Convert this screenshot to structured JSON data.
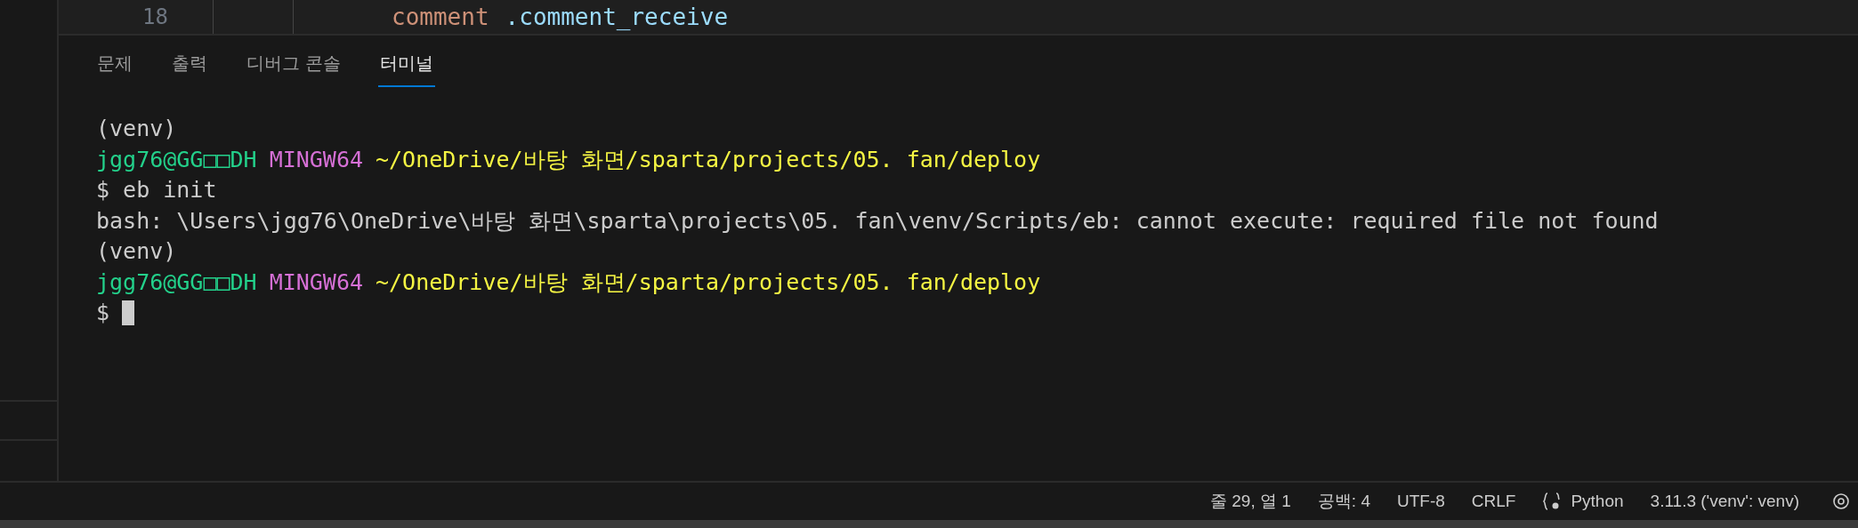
{
  "editor": {
    "line_number": "18",
    "code": [
      {
        "text": "comment",
        "kind": "string"
      },
      {
        "text": ".comment_receive",
        "kind": "property"
      }
    ]
  },
  "panel_tabs": [
    {
      "label": "문제",
      "selected": false
    },
    {
      "label": "출력",
      "selected": false
    },
    {
      "label": "디버그 콘솔",
      "selected": false
    },
    {
      "label": "터미널",
      "selected": true
    }
  ],
  "terminal": {
    "lines": [
      {
        "segments": [
          {
            "text": "(venv)",
            "kind": "plain"
          }
        ]
      },
      {
        "segments": [
          {
            "text": "jgg76@GG□□DH",
            "kind": "user"
          },
          {
            "text": "MINGW64",
            "kind": "system"
          },
          {
            "text": "~/OneDrive/바탕 화면/sparta/projects/05. fan/deploy",
            "kind": "path"
          }
        ]
      },
      {
        "segments": [
          {
            "text": "$ eb init",
            "kind": "plain"
          }
        ]
      },
      {
        "segments": [
          {
            "text": "bash: \\Users\\jgg76\\OneDrive\\바탕 화면\\sparta\\projects\\05. fan\\venv/Scripts/eb: cannot execute: required file not found",
            "kind": "plain"
          }
        ]
      },
      {
        "segments": [
          {
            "text": "(venv)",
            "kind": "plain"
          }
        ]
      },
      {
        "segments": [
          {
            "text": "jgg76@GG□□DH",
            "kind": "user"
          },
          {
            "text": "MINGW64",
            "kind": "system"
          },
          {
            "text": "~/OneDrive/바탕 화면/sparta/projects/05. fan/deploy",
            "kind": "path"
          }
        ]
      },
      {
        "segments": [
          {
            "text": "$",
            "kind": "plain"
          }
        ],
        "cursor": true
      }
    ]
  },
  "status_bar": [
    {
      "kind": "text",
      "text": "줄 29, 열 1"
    },
    {
      "kind": "text",
      "text": "공백: 4"
    },
    {
      "kind": "text",
      "text": "UTF-8"
    },
    {
      "kind": "text",
      "text": "CRLF"
    },
    {
      "kind": "language",
      "text": "Python"
    },
    {
      "kind": "text",
      "text": "3.11.3 ('venv': venv)"
    }
  ]
}
